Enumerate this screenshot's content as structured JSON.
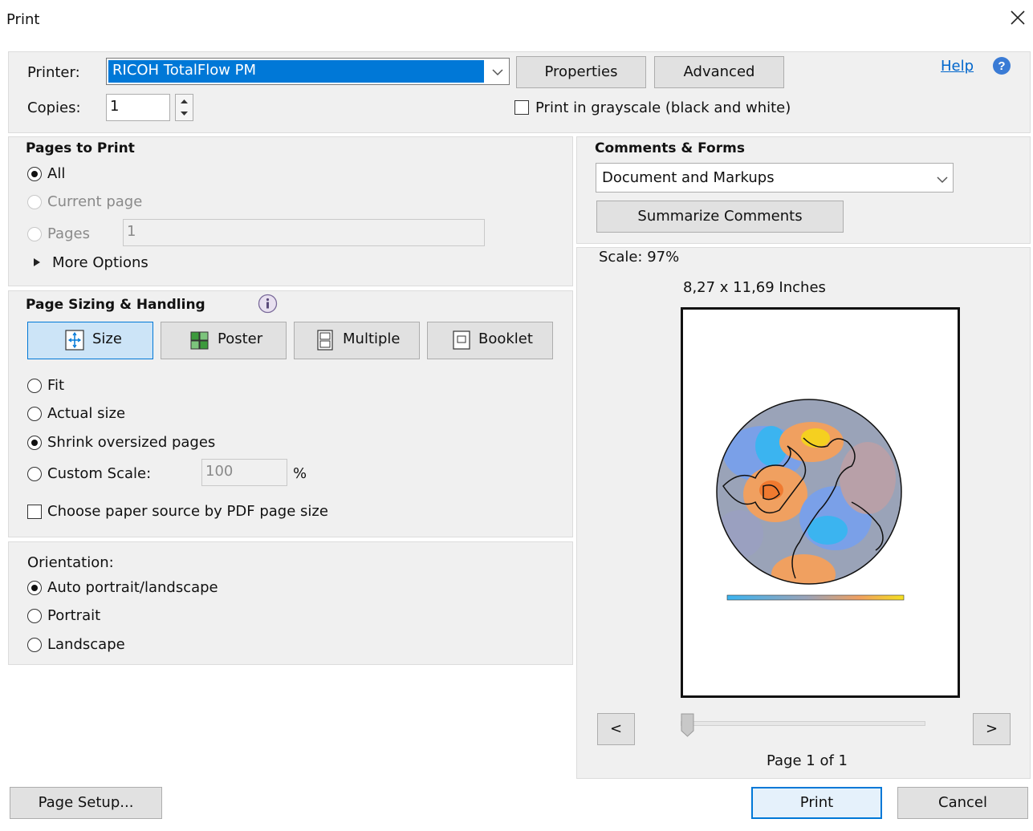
{
  "window": {
    "title": "Print"
  },
  "printer": {
    "label": "Printer:",
    "selected": "RICOH TotalFlow PM",
    "properties_label": "Properties",
    "advanced_label": "Advanced",
    "help_label": "Help"
  },
  "copies": {
    "label": "Copies:",
    "value": "1"
  },
  "grayscale": {
    "label": "Print in grayscale (black and white)",
    "checked": false
  },
  "pages_to_print": {
    "heading": "Pages to Print",
    "all_label": "All",
    "current_label": "Current page",
    "pages_label": "Pages",
    "pages_value": "1",
    "more_options_label": "More Options",
    "selected": "All"
  },
  "sizing": {
    "heading": "Page Sizing & Handling",
    "buttons": [
      "Size",
      "Poster",
      "Multiple",
      "Booklet"
    ],
    "selected_button": "Size",
    "fit_label": "Fit",
    "actual_label": "Actual size",
    "shrink_label": "Shrink oversized pages",
    "custom_label": "Custom Scale:",
    "custom_value": "100",
    "percent": "%",
    "paper_source_label": "Choose paper source by PDF page size",
    "selected": "Shrink oversized pages"
  },
  "orientation": {
    "heading": "Orientation:",
    "auto_label": "Auto portrait/landscape",
    "portrait_label": "Portrait",
    "landscape_label": "Landscape",
    "selected": "Auto portrait/landscape"
  },
  "comments_forms": {
    "heading": "Comments & Forms",
    "selected": "Document and Markups",
    "summarize_label": "Summarize Comments"
  },
  "preview": {
    "scale_text": "Scale:  97%",
    "dimensions": "8,27 x 11,69 Inches",
    "prev_label": "<",
    "next_label": ">",
    "page_text": "Page 1 of 1",
    "slider_position": 0
  },
  "footer": {
    "page_setup_label": "Page Setup...",
    "print_label": "Print",
    "cancel_label": "Cancel"
  },
  "colors": {
    "accent": "#0078d7",
    "link": "#0066cc",
    "selection": "#0078d7"
  }
}
